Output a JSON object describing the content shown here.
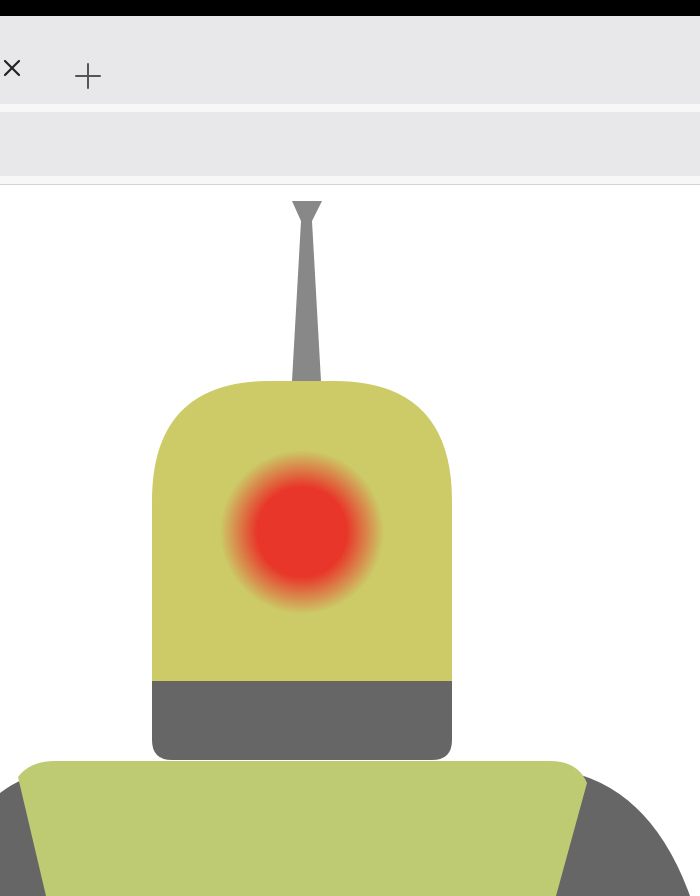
{
  "browser": {
    "tab_close_icon": "close-icon",
    "new_tab_icon": "plus-icon",
    "icon_color": "#555555"
  },
  "robot": {
    "head_color": "#cccb67",
    "neck_color": "#666666",
    "body_color": "#bfcb73",
    "arm_color": "#666666",
    "antenna_color": "#888888",
    "eye_color": "#e8372a"
  }
}
